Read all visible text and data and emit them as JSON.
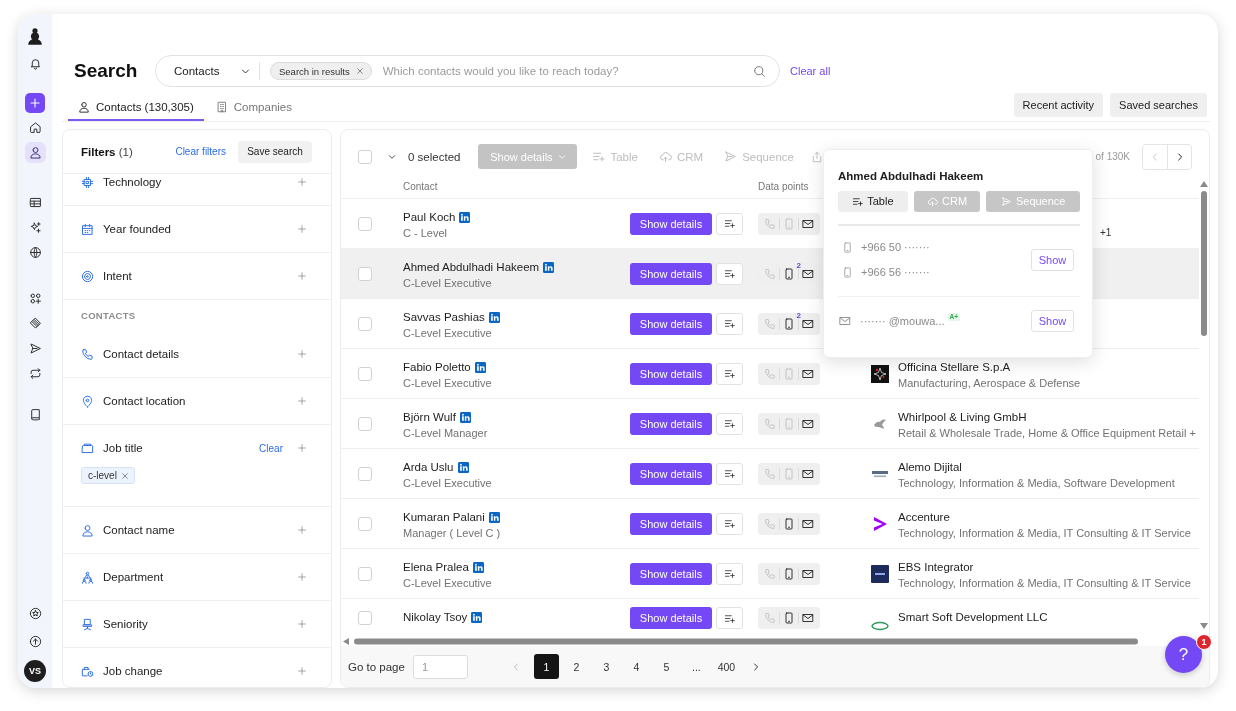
{
  "sidebar": {
    "nav_groups": [
      [
        {
          "selected": false
        },
        {
          "selected": true
        }
      ],
      [
        {
          "selected": false
        },
        {
          "selected": false
        },
        {
          "selected": false
        }
      ],
      [
        {
          "selected": false
        },
        {
          "selected": false
        },
        {
          "selected": false
        },
        {
          "selected": false
        }
      ],
      [
        {
          "selected": false
        }
      ]
    ],
    "avatar": "VS"
  },
  "header": {
    "title": "Search",
    "scope": "Contacts",
    "chip": "Search in results",
    "placeholder": "Which contacts would you like to reach today?",
    "clear_all": "Clear all"
  },
  "tabs": [
    {
      "label": "Contacts (130,305)",
      "selected": true
    },
    {
      "label": "Companies",
      "selected": false
    }
  ],
  "actions": [
    "Recent activity",
    "Saved searches"
  ],
  "filters": {
    "title": "**Filters** (1)",
    "clear": "Clear filters",
    "save": "Save search",
    "items": [
      {
        "kind": "filter",
        "label": "Technology"
      },
      {
        "kind": "filter",
        "label": "Year founded"
      },
      {
        "kind": "filter",
        "label": "Intent"
      },
      {
        "kind": "section",
        "label": "CONTACTS"
      },
      {
        "kind": "filter",
        "label": "Contact details"
      },
      {
        "kind": "filter",
        "label": "Contact location"
      },
      {
        "kind": "filter",
        "label": "Job title",
        "clear": "Clear",
        "chips": [
          "c-level"
        ]
      },
      {
        "kind": "filter",
        "label": "Contact name"
      },
      {
        "kind": "filter",
        "label": "Department"
      },
      {
        "kind": "filter",
        "label": "Seniority"
      },
      {
        "kind": "filter",
        "label": "Job change"
      }
    ]
  },
  "results": {
    "toolbar": {
      "checked": false,
      "selected": "0 selected",
      "show_details": {
        "label": "Show details",
        "disabled": true
      },
      "actions": [
        {
          "label": "Table",
          "disabled": true
        },
        {
          "label": "CRM",
          "disabled": true
        },
        {
          "label": "Sequence",
          "disabled": true
        }
      ],
      "share_disabled": true,
      "range": "of 130K",
      "prev_disabled": true,
      "next_disabled": false
    },
    "columns": [
      "Contact",
      "Data points"
    ],
    "rows": [
      {
        "name": "Paul Koch",
        "title": "C - Level",
        "checked": false,
        "highlighted": false,
        "action": "Show details",
        "data_points": [
          {
            "kind": "phone",
            "available": false
          },
          {
            "kind": "mobile",
            "available": false
          },
          {
            "kind": "email",
            "available": true
          }
        ],
        "company": {
          "more": "+1"
        }
      },
      {
        "name": "Ahmed Abdulhadi Hakeem",
        "title": "C-Level Executive",
        "checked": false,
        "highlighted": true,
        "action": "Show details",
        "data_points": [
          {
            "kind": "phone",
            "available": false
          },
          {
            "kind": "mobile",
            "available": true,
            "count": "2"
          },
          {
            "kind": "email",
            "available": true
          }
        ]
      },
      {
        "name": "Savvas Pashias",
        "title": "C-Level Executive",
        "checked": false,
        "highlighted": false,
        "action": "Show details",
        "data_points": [
          {
            "kind": "phone",
            "available": false
          },
          {
            "kind": "mobile",
            "available": true,
            "count": "2"
          },
          {
            "kind": "email",
            "available": true
          }
        ]
      },
      {
        "name": "Fabio Poletto",
        "title": "C-Level Executive",
        "checked": false,
        "highlighted": false,
        "action": "Show details",
        "data_points": [
          {
            "kind": "phone",
            "available": false
          },
          {
            "kind": "mobile",
            "available": false
          },
          {
            "kind": "email",
            "available": true
          }
        ],
        "company": {
          "name": "Officina Stellare S.p.A",
          "industry": "Manufacturing, Aerospace & Defense"
        }
      },
      {
        "name": "Björn Wulf",
        "title": "C-Level Manager",
        "checked": false,
        "highlighted": false,
        "action": "Show details",
        "data_points": [
          {
            "kind": "phone",
            "available": false
          },
          {
            "kind": "mobile",
            "available": false
          },
          {
            "kind": "email",
            "available": true
          }
        ],
        "company": {
          "name": "Whirlpool & Living GmbH",
          "industry": "Retail & Wholesale Trade, Home & Office Equipment Retail +"
        }
      },
      {
        "name": "Arda Uslu",
        "title": "C-Level Executive",
        "checked": false,
        "highlighted": false,
        "action": "Show details",
        "data_points": [
          {
            "kind": "phone",
            "available": false
          },
          {
            "kind": "mobile",
            "available": false
          },
          {
            "kind": "email",
            "available": true
          }
        ],
        "company": {
          "name": "Alemo Dijital",
          "industry": "Technology, Information & Media, Software Development"
        }
      },
      {
        "name": "Kumaran Palani",
        "title": "Manager ( Level C )",
        "checked": false,
        "highlighted": false,
        "action": "Show details",
        "data_points": [
          {
            "kind": "phone",
            "available": false
          },
          {
            "kind": "mobile",
            "available": true
          },
          {
            "kind": "email",
            "available": true
          }
        ],
        "company": {
          "name": "Accenture",
          "industry": "Technology, Information & Media, IT Consulting & IT Service"
        }
      },
      {
        "name": "Elena Pralea",
        "title": "C-Level Executive",
        "checked": false,
        "highlighted": false,
        "action": "Show details",
        "data_points": [
          {
            "kind": "phone",
            "available": false
          },
          {
            "kind": "mobile",
            "available": true
          },
          {
            "kind": "email",
            "available": true
          }
        ],
        "company": {
          "name": "EBS Integrator",
          "industry": "Technology, Information & Media, IT Consulting & IT Service"
        }
      },
      {
        "name": "Nikolay Tsoy",
        "checked": false,
        "highlighted": false,
        "action": "Show details",
        "data_points": [
          {
            "kind": "phone",
            "available": false
          },
          {
            "kind": "mobile",
            "available": true
          },
          {
            "kind": "email",
            "available": true
          }
        ],
        "company": {
          "name": "Smart Soft Development LLC"
        }
      }
    ],
    "popup": {
      "name": "Ahmed Abdulhadi Hakeem",
      "actions": [
        {
          "label": "Table",
          "disabled": false
        },
        {
          "label": "CRM",
          "disabled": true
        },
        {
          "label": "Sequence",
          "disabled": true
        }
      ],
      "phones": [
        "+966 50 ·······",
        "+966 56 ·······"
      ],
      "phone_action": "Show",
      "email": "······· @mouwa...",
      "email_grade": "A+",
      "email_action": "Show"
    },
    "pagination": {
      "label": "Go to page",
      "placeholder": "1",
      "prev_disabled": true,
      "next_disabled": false,
      "pages": [
        {
          "label": "1",
          "selected": true
        },
        {
          "label": "2",
          "selected": false
        },
        {
          "label": "3",
          "selected": false
        },
        {
          "label": "4",
          "selected": false
        },
        {
          "label": "5",
          "selected": false
        },
        {
          "label": "...",
          "selected": false
        },
        {
          "label": "400",
          "selected": false
        }
      ]
    }
  },
  "help": {
    "label": "?",
    "badge": "1"
  }
}
